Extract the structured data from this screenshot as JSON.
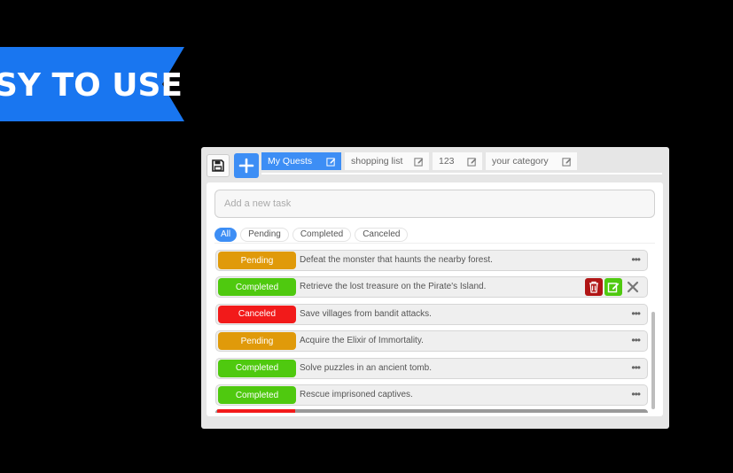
{
  "banner": {
    "text": "SY TO USE",
    "color": "#1976f0"
  },
  "toolbar": {
    "save_icon": "floppy-disk-icon",
    "add_icon": "plus-icon"
  },
  "tabs": [
    {
      "label": "My Quests",
      "active": true
    },
    {
      "label": "shopping list",
      "active": false
    },
    {
      "label": "123",
      "active": false
    },
    {
      "label": "your category",
      "active": false
    }
  ],
  "task_input": {
    "placeholder": "Add a new task",
    "value": ""
  },
  "filters": [
    {
      "label": "All",
      "active": true
    },
    {
      "label": "Pending",
      "active": false
    },
    {
      "label": "Completed",
      "active": false
    },
    {
      "label": "Canceled",
      "active": false
    }
  ],
  "tasks": [
    {
      "status": "Pending",
      "description": "Defeat the monster that haunts the nearby forest."
    },
    {
      "status": "Completed",
      "description": "Retrieve the lost treasure on the Pirate's Island.",
      "hovered": true
    },
    {
      "status": "Canceled",
      "description": "Save villages from bandit attacks."
    },
    {
      "status": "Pending",
      "description": "Acquire the Elixir of Immortality."
    },
    {
      "status": "Completed",
      "description": "Solve puzzles in an ancient tomb."
    },
    {
      "status": "Completed",
      "description": "Rescue imprisoned captives."
    }
  ],
  "row_menu_label": "•••",
  "colors": {
    "accent": "#3d8ef5",
    "pending": "#e09a0a",
    "completed": "#4fc90f",
    "canceled": "#f21a1a",
    "delete": "#b01515"
  }
}
